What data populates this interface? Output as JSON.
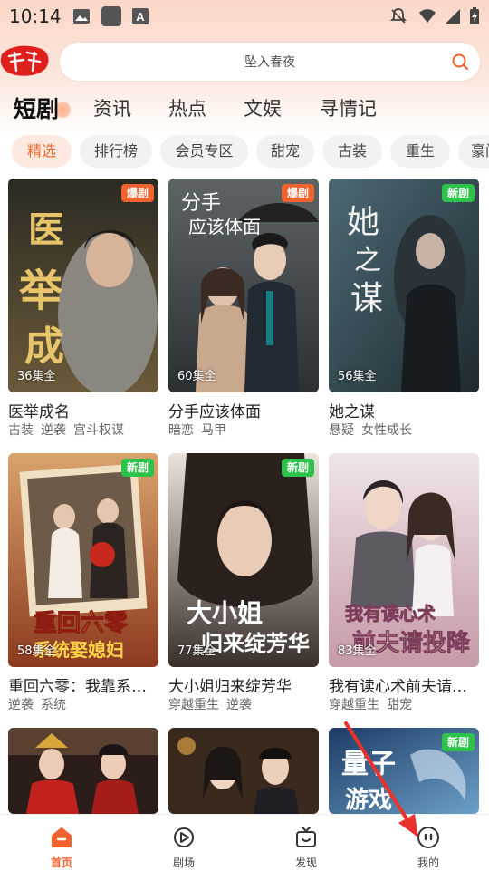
{
  "status": {
    "time": "10:14"
  },
  "header": {
    "logo_icon": "app-logo-icon",
    "search_placeholder": "坠入春夜"
  },
  "tabs": [
    {
      "label": "短剧",
      "active": true
    },
    {
      "label": "资讯"
    },
    {
      "label": "热点"
    },
    {
      "label": "文娱"
    },
    {
      "label": "寻情记"
    }
  ],
  "chips": [
    {
      "label": "精选",
      "active": true
    },
    {
      "label": "排行榜"
    },
    {
      "label": "会员专区"
    },
    {
      "label": "甜宠"
    },
    {
      "label": "古装"
    },
    {
      "label": "重生"
    },
    {
      "label": "豪门"
    }
  ],
  "cards": [
    {
      "title": "医举成名",
      "tags": [
        "古装",
        "逆袭",
        "宫斗权谋"
      ],
      "episodes": "36集全",
      "badge": "爆剧",
      "badge_type": "hot",
      "poster_text": "医举成名"
    },
    {
      "title": "分手应该体面",
      "tags": [
        "暗恋",
        "马甲"
      ],
      "episodes": "60集全",
      "badge": "爆剧",
      "badge_type": "hot",
      "poster_text": "分手应该体面"
    },
    {
      "title": "她之谋",
      "tags": [
        "悬疑",
        "女性成长"
      ],
      "episodes": "56集全",
      "badge": "新剧",
      "badge_type": "new",
      "poster_text": "她之谋"
    },
    {
      "title": "重回六零：我靠系…",
      "tags": [
        "逆袭",
        "系统"
      ],
      "episodes": "58集全",
      "badge": "新剧",
      "badge_type": "new",
      "poster_text": "重回六零系统娶媳妇"
    },
    {
      "title": "大小姐归来绽芳华",
      "tags": [
        "穿越重生",
        "逆袭"
      ],
      "episodes": "77集全",
      "badge": "新剧",
      "badge_type": "new",
      "poster_text": "大小姐归来绽芳华"
    },
    {
      "title": "我有读心术前夫请…",
      "tags": [
        "穿越重生",
        "甜宠"
      ],
      "episodes": "83集全",
      "badge": "",
      "badge_type": "",
      "poster_text": "我有读心术前夫请投降"
    },
    {
      "title": "",
      "tags": [],
      "episodes": "",
      "badge": "",
      "badge_type": "",
      "poster_text": ""
    },
    {
      "title": "",
      "tags": [],
      "episodes": "",
      "badge": "",
      "badge_type": "",
      "poster_text": ""
    },
    {
      "title": "",
      "tags": [],
      "episodes": "",
      "badge": "新剧",
      "badge_type": "new",
      "poster_text": "量子游戏传说"
    }
  ],
  "bottom_nav": [
    {
      "label": "首页",
      "icon": "home-icon",
      "active": true
    },
    {
      "label": "剧场",
      "icon": "theater-play-icon"
    },
    {
      "label": "发现",
      "icon": "tv-discover-icon"
    },
    {
      "label": "我的",
      "icon": "profile-icon"
    }
  ],
  "colors": {
    "accent": "#f0622e",
    "new_badge": "#2dc24a",
    "annotation_arrow": "#e8322b"
  }
}
